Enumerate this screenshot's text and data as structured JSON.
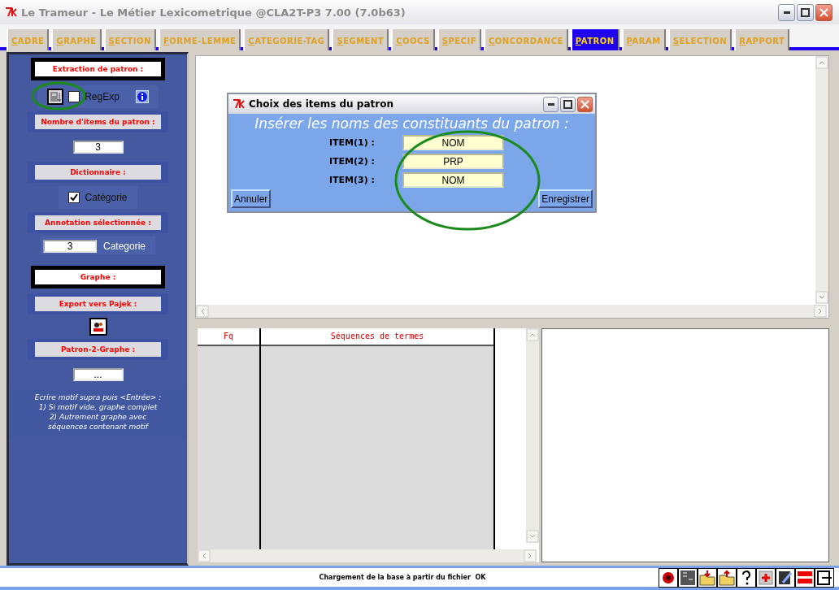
{
  "window": {
    "title": "Le Trameur - Le Métier Lexicometrique @CLA2T-P3 7.00 (7.0b63)"
  },
  "tabs": [
    {
      "label": "CADRE",
      "selected": false
    },
    {
      "label": "GRAPHE",
      "selected": false
    },
    {
      "label": "SECTION",
      "selected": false
    },
    {
      "label": "FORME-LEMME",
      "selected": false
    },
    {
      "label": "CATEGORIE-TAG",
      "selected": false
    },
    {
      "label": "SEGMENT",
      "selected": false
    },
    {
      "label": "COOCS",
      "selected": false
    },
    {
      "label": "SPECIF",
      "selected": false
    },
    {
      "label": "CONCORDANCE",
      "selected": false
    },
    {
      "label": "PATRON",
      "selected": true
    },
    {
      "label": "PARAM",
      "selected": false
    },
    {
      "label": "SELECTION",
      "selected": false
    },
    {
      "label": "RAPPORT",
      "selected": false
    }
  ],
  "sidebar": {
    "items": [
      {
        "kind": "framed",
        "label": "Extraction de patron :"
      },
      {
        "kind": "tools",
        "checkbox_label": "RegExp",
        "checked": false
      },
      {
        "kind": "heading",
        "label": "Nombre d'items du patron :"
      },
      {
        "kind": "field",
        "value": "3"
      },
      {
        "kind": "heading",
        "label": "Dictionnaire :"
      },
      {
        "kind": "checkbox",
        "label": "Catégorie",
        "checked": true
      },
      {
        "kind": "field_label",
        "heading": "Annotation sélectionnée :",
        "value": "3",
        "label": "Categorie"
      },
      {
        "kind": "framed",
        "label": "Graphe :"
      },
      {
        "kind": "heading",
        "label": "Export vers Pajek :"
      },
      {
        "kind": "icon"
      },
      {
        "kind": "heading",
        "label": "Patron-2-Graphe :"
      },
      {
        "kind": "field",
        "value": "..."
      },
      {
        "kind": "note",
        "lines": [
          "Ecrire motif supra puis <Entrée> :",
          "1) Si motif vide, graphe complet",
          "2)  Autrement graphe avec",
          "séquences contenant motif"
        ]
      }
    ]
  },
  "dialog": {
    "title": "Choix des items du patron",
    "prompt": "Insérer les noms des constituants du patron :",
    "items": [
      {
        "label": "ITEM(1) :",
        "value": "NOM"
      },
      {
        "label": "ITEM(2) :",
        "value": "PRP"
      },
      {
        "label": "ITEM(3) :",
        "value": "NOM"
      }
    ],
    "buttons": [
      "Annuler",
      "Enregistrer"
    ]
  },
  "table": {
    "columns": [
      "Fq",
      "Séquences de termes"
    ]
  },
  "status_bar": {
    "message": "Chargement de la base à partir du fichier  OK"
  }
}
